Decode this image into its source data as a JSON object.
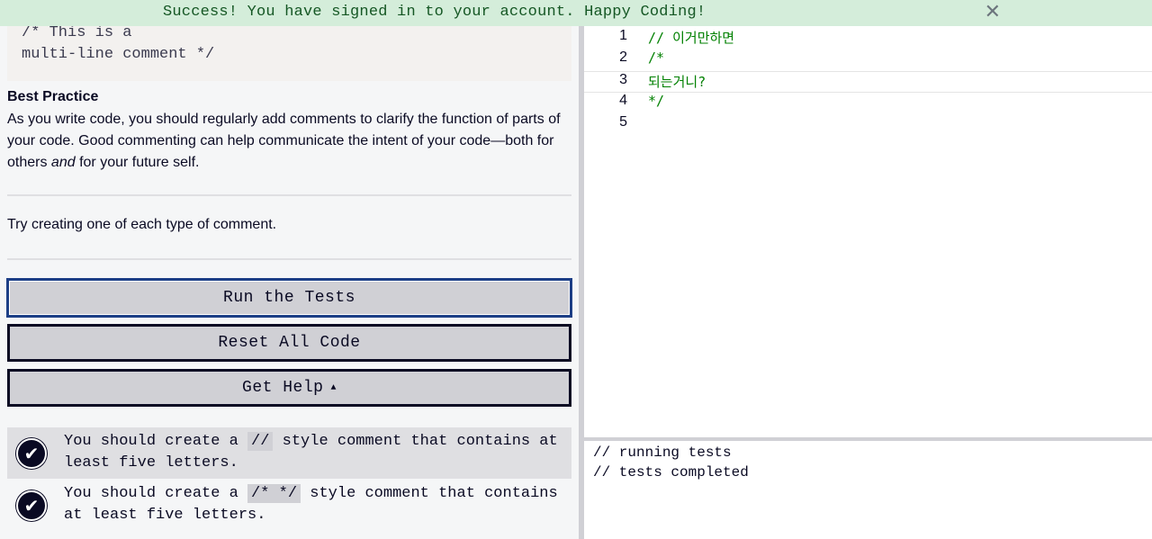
{
  "flash": {
    "message": "Success! You have signed in to your account. Happy Coding!",
    "close": "✕"
  },
  "instructions": {
    "code_example": [
      "/* This is a",
      "multi-line comment */"
    ],
    "best_practice_title": "Best Practice",
    "best_practice_pre": "As you write code, you should regularly add comments to clarify the function of parts of your code. Good commenting can help communicate the intent of your code—both for others ",
    "best_practice_em": "and",
    "best_practice_post": " for your future self.",
    "task": "Try creating one of each type of comment."
  },
  "buttons": {
    "run": "Run the Tests",
    "reset": "Reset All Code",
    "help": "Get Help",
    "help_caret": "▲"
  },
  "tests": [
    {
      "pre": "You should create a ",
      "code": "//",
      "post": " style comment that contains at least five letters.",
      "status_icon": "check-icon"
    },
    {
      "pre": "You should create a ",
      "code": "/* */",
      "post": " style comment that contains at least five letters.",
      "status_icon": "check-icon"
    }
  ],
  "editor": {
    "lines": [
      {
        "num": "1",
        "text": "//  이거만하면"
      },
      {
        "num": "2",
        "text": "/*"
      },
      {
        "num": "3",
        "text": "되는거니?"
      },
      {
        "num": "4",
        "text": "*/"
      },
      {
        "num": "5",
        "text": ""
      }
    ]
  },
  "console": {
    "lines": [
      "// running tests",
      "// tests completed"
    ]
  }
}
